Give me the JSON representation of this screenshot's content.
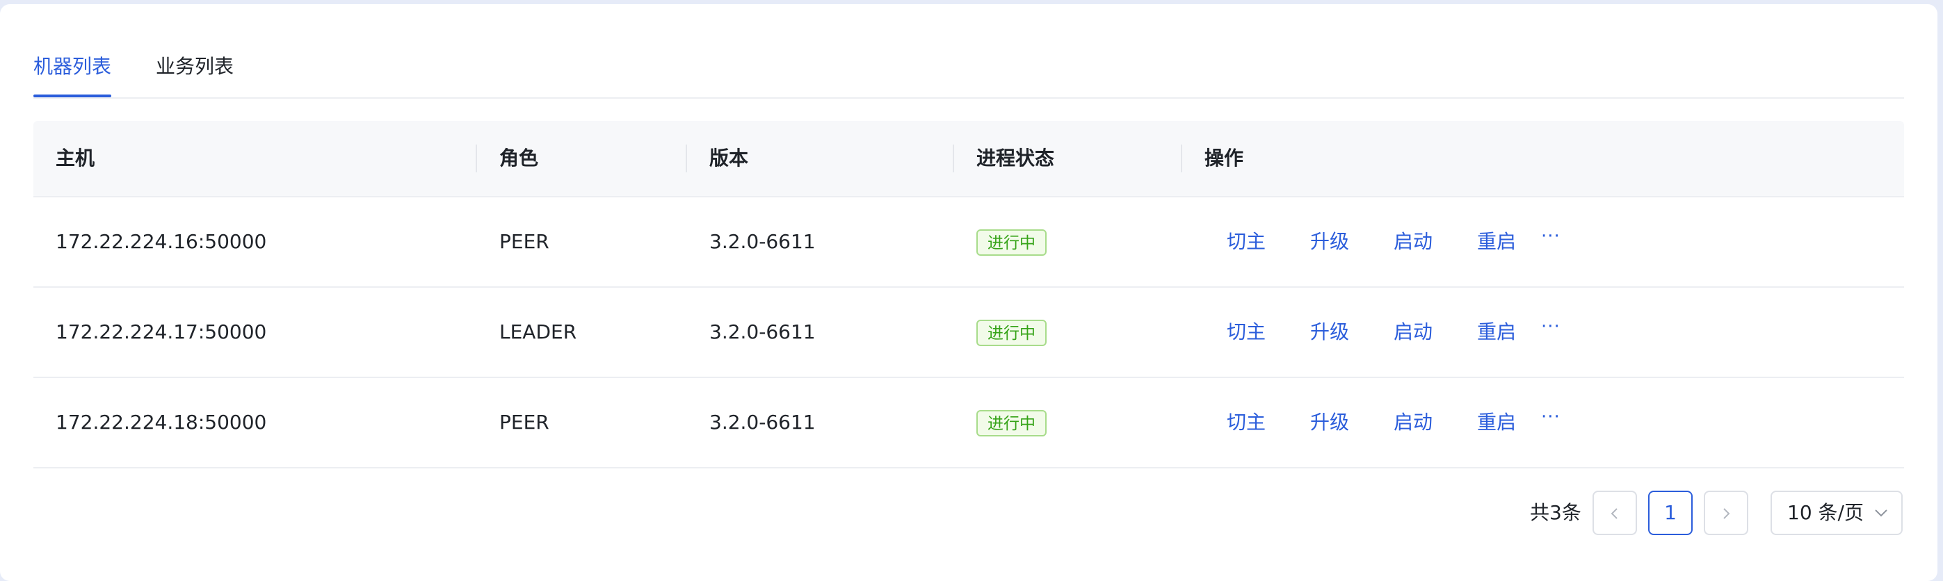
{
  "tabs": [
    {
      "label": "机器列表",
      "active": true
    },
    {
      "label": "业务列表",
      "active": false
    }
  ],
  "table": {
    "columns": [
      "主机",
      "角色",
      "版本",
      "进程状态",
      "操作"
    ],
    "rows": [
      {
        "host": "172.22.224.16:50000",
        "role": "PEER",
        "version": "3.2.0-6611",
        "status": "进行中"
      },
      {
        "host": "172.22.224.17:50000",
        "role": "LEADER",
        "version": "3.2.0-6611",
        "status": "进行中"
      },
      {
        "host": "172.22.224.18:50000",
        "role": "PEER",
        "version": "3.2.0-6611",
        "status": "进行中"
      }
    ],
    "actions": [
      "切主",
      "升级",
      "启动",
      "重启"
    ],
    "more_label": "···"
  },
  "pagination": {
    "total_label": "共3条",
    "current_page": "1",
    "page_size_label": "10 条/页"
  },
  "colors": {
    "accent": "#2b5ddb",
    "status_green": "#35a317",
    "status_bg": "#f2fbe9",
    "header_bg": "#f7f8fa"
  },
  "icons": {
    "prev": "chevron-left-icon",
    "next": "chevron-right-icon",
    "dropdown": "chevron-down-icon",
    "more": "ellipsis-icon"
  }
}
